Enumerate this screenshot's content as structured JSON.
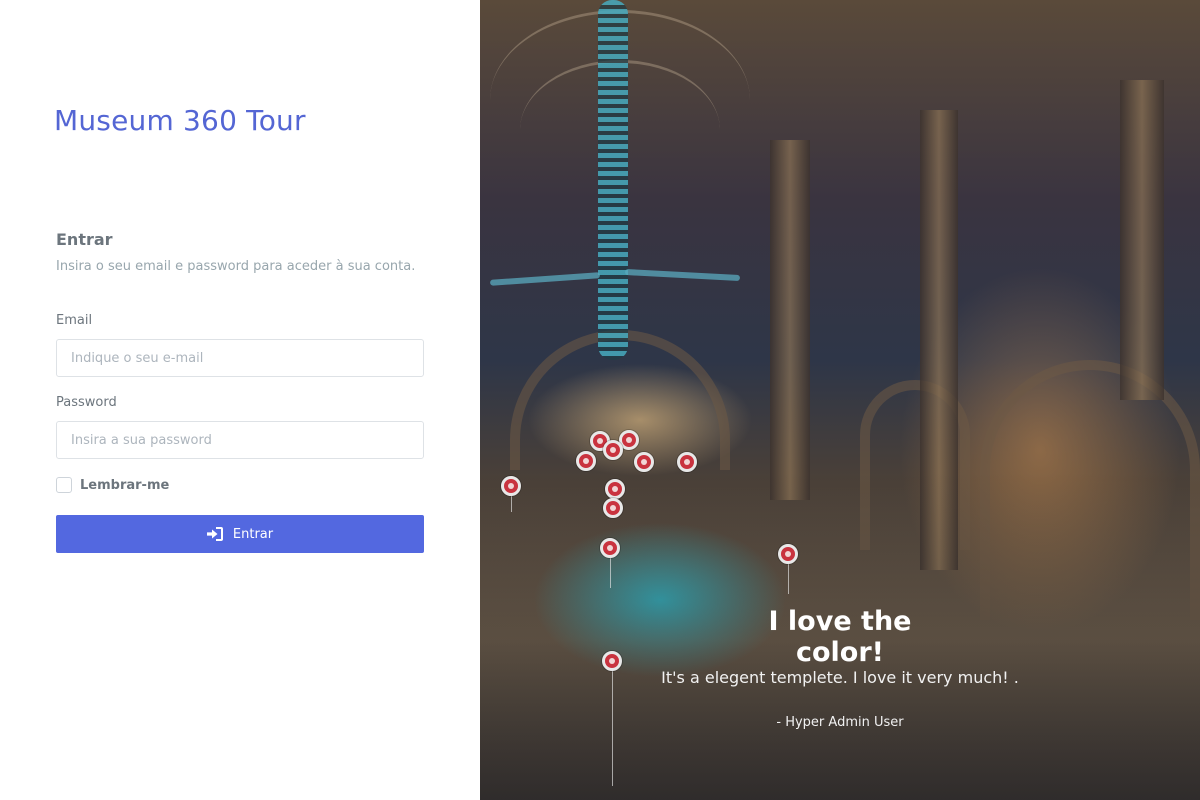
{
  "brand": {
    "title": "Museum 360 Tour"
  },
  "login": {
    "heading": "Entrar",
    "subtitle": "Insira o seu email e password para aceder à sua conta.",
    "email": {
      "label": "Email",
      "placeholder": "Indique o seu e-mail",
      "value": ""
    },
    "password": {
      "label": "Password",
      "placeholder": "Insira a sua password",
      "value": ""
    },
    "remember": {
      "label": "Lembrar-me",
      "checked": false
    },
    "submit": {
      "label": "Entrar",
      "icon": "login-icon"
    }
  },
  "testimonial": {
    "title": "I love the color!",
    "quote": "It's a elegent templete. I love it very much! .",
    "author": "- Hyper Admin User"
  },
  "colors": {
    "brand": "#5466d4",
    "primary_button": "#5368e0",
    "hotspot": "#c9333f"
  }
}
